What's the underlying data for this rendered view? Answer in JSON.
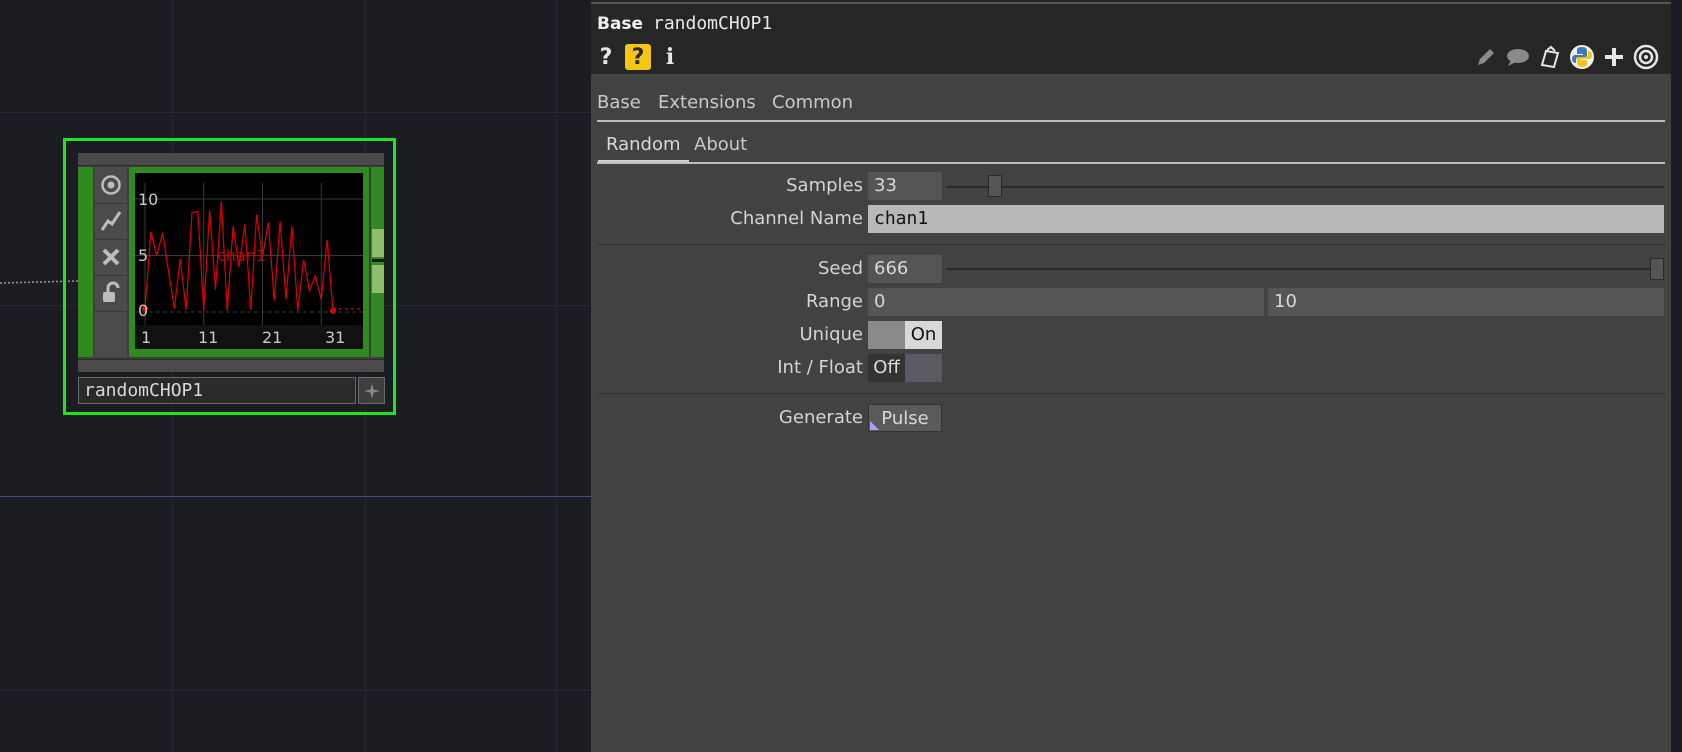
{
  "node": {
    "name": "randomCHOP1",
    "viewer": {
      "y_labels": [
        "10",
        "5",
        "0"
      ],
      "x_labels": [
        "1",
        "11",
        "21",
        "31"
      ],
      "channel_label": "chan1"
    }
  },
  "chart_data": {
    "type": "line",
    "x": [
      1,
      2,
      3,
      4,
      5,
      6,
      7,
      8,
      9,
      10,
      11,
      12,
      13,
      14,
      15,
      16,
      17,
      18,
      19,
      20,
      21,
      22,
      23,
      24,
      25,
      26,
      27,
      28,
      29,
      30,
      31,
      32,
      33
    ],
    "series": [
      {
        "name": "chan1",
        "values": [
          0.3,
          7.1,
          5.0,
          7.0,
          3.6,
          0.3,
          4.7,
          0.2,
          8.8,
          8.9,
          0.1,
          9.0,
          2.0,
          9.8,
          0.1,
          7.6,
          4.0,
          7.8,
          0.2,
          8.6,
          4.9,
          7.9,
          1.0,
          8.0,
          1.1,
          7.6,
          0.1,
          4.6,
          1.9,
          3.2,
          1.1,
          6.4,
          0.1
        ]
      }
    ],
    "xlim": [
      1,
      33
    ],
    "ylim": [
      0,
      10
    ],
    "grid": true,
    "line_color": "#e00000"
  },
  "panel": {
    "op_type": "Base",
    "op_name": "randomCHOP1",
    "page_tabs": [
      "Base",
      "Extensions",
      "Common"
    ],
    "param_tabs": [
      "Random",
      "About"
    ],
    "params": {
      "samples": {
        "label": "Samples",
        "value": "33",
        "slider_fraction": 0.06
      },
      "channel_name": {
        "label": "Channel Name",
        "value": "chan1"
      },
      "seed": {
        "label": "Seed",
        "value": "666",
        "slider_fraction": 1.0
      },
      "range": {
        "label": "Range",
        "min": "0",
        "max": "10"
      },
      "unique": {
        "label": "Unique",
        "value": "On"
      },
      "int_float": {
        "label": "Int / Float",
        "value": "Off"
      },
      "generate": {
        "label": "Generate",
        "value": "Pulse"
      }
    }
  },
  "colors": {
    "accent_selected": "#1fe51f",
    "node_green": "#2f8a1f",
    "plot_red": "#e00000",
    "python_yellow": "#f5c518",
    "python_blue": "#3d78b8"
  }
}
